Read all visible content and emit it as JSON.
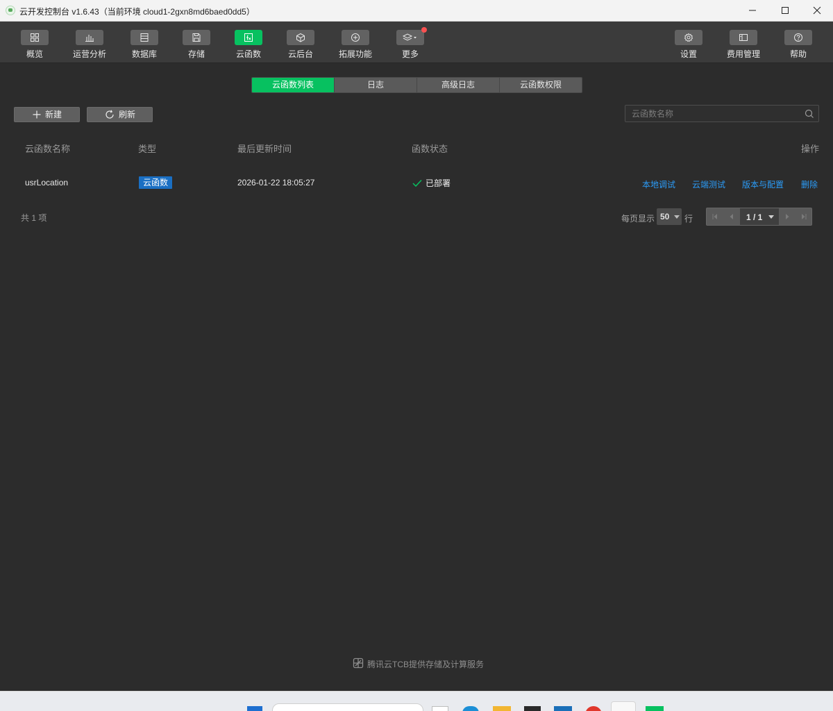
{
  "window": {
    "title": "云开发控制台 v1.6.43（当前环境 cloud1-2gxn8md6baed0dd5）"
  },
  "toolbar": {
    "items": [
      {
        "label": "概览",
        "icon": "dashboard-icon"
      },
      {
        "label": "运营分析",
        "icon": "analytics-icon"
      },
      {
        "label": "数据库",
        "icon": "database-icon"
      },
      {
        "label": "存储",
        "icon": "storage-icon"
      },
      {
        "label": "云函数",
        "icon": "cloud-function-icon",
        "active": true
      },
      {
        "label": "云后台",
        "icon": "cloud-backend-icon"
      },
      {
        "label": "拓展功能",
        "icon": "extension-icon"
      },
      {
        "label": "更多",
        "icon": "layers-icon"
      }
    ],
    "right_items": [
      {
        "label": "设置",
        "icon": "gear-icon"
      },
      {
        "label": "费用管理",
        "icon": "billing-icon"
      },
      {
        "label": "帮助",
        "icon": "help-icon"
      }
    ]
  },
  "tabs": [
    "云函数列表",
    "日志",
    "高级日志",
    "云函数权限"
  ],
  "actions": {
    "new_label": "新建",
    "refresh_label": "刷新"
  },
  "search": {
    "placeholder": "云函数名称",
    "value": ""
  },
  "table": {
    "headers": [
      "云函数名称",
      "类型",
      "最后更新时间",
      "函数状态",
      "操作"
    ],
    "rows": [
      {
        "name": "usrLocation",
        "type": "云函数",
        "updated": "2026-01-22 18:05:27",
        "status": "已部署",
        "operations": [
          "本地调试",
          "云端测试",
          "版本与配置",
          "删除"
        ]
      }
    ]
  },
  "pagination": {
    "total_text": "共 1 项",
    "per_page_label": "每页显示",
    "per_page_value": "50",
    "per_page_unit": "行",
    "current": "1 / 1"
  },
  "footer": {
    "text": "腾讯云TCB提供存储及计算服务"
  },
  "colors": {
    "accent": "#07c160",
    "link": "#2b9cf8",
    "badge": "#1a6fc3",
    "notification": "#fa5151"
  }
}
